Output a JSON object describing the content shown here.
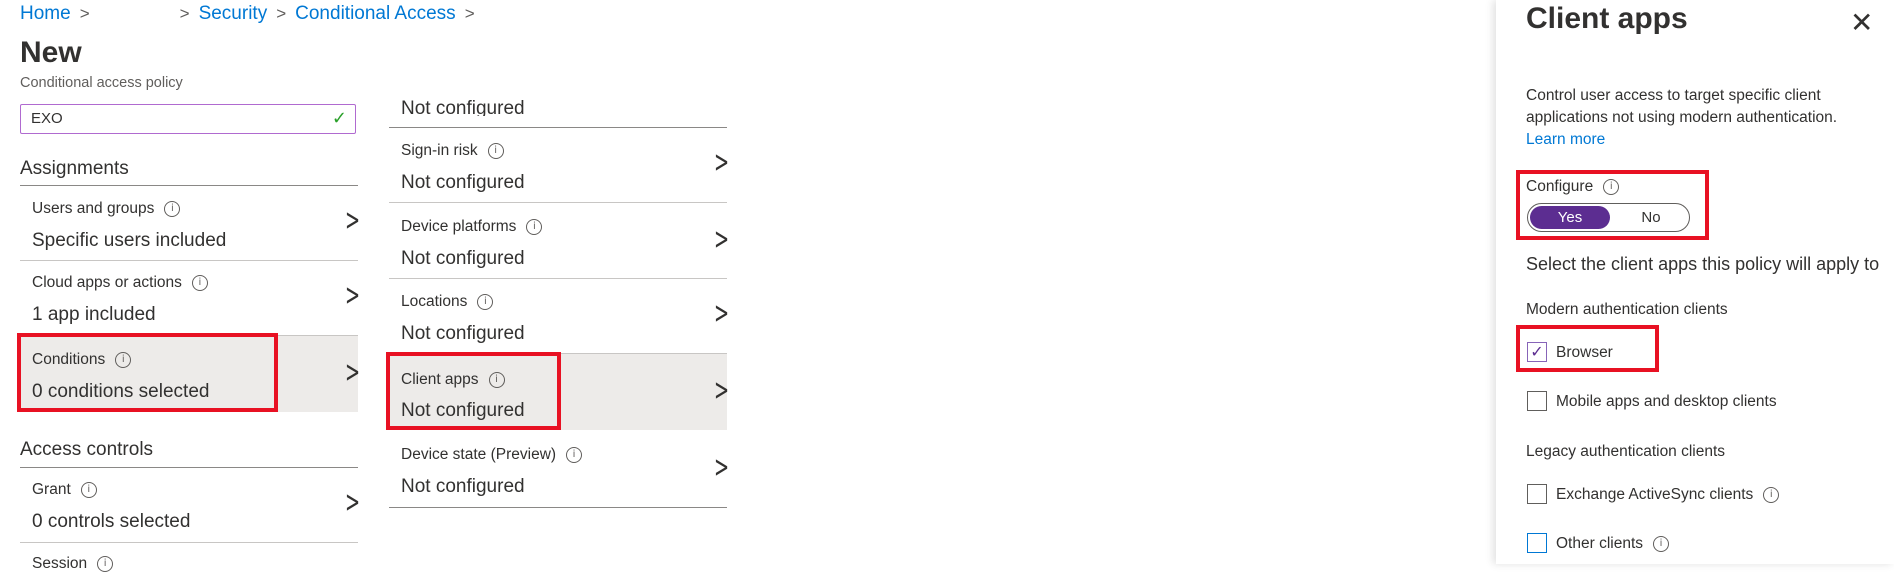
{
  "breadcrumb": {
    "home": "Home",
    "security": "Security",
    "conditional_access": "Conditional Access",
    "sep": ">"
  },
  "page": {
    "title": "New",
    "subtitle": "Conditional access policy",
    "name_value": "EXO"
  },
  "assignments": {
    "title": "Assignments",
    "rows": [
      {
        "label": "Users and groups",
        "value": "Specific users included"
      },
      {
        "label": "Cloud apps or actions",
        "value": "1 app included"
      },
      {
        "label": "Conditions",
        "value": "0 conditions selected"
      }
    ]
  },
  "access_controls": {
    "title": "Access controls",
    "rows": [
      {
        "label": "Grant",
        "value": "0 controls selected"
      },
      {
        "label": "Session"
      }
    ]
  },
  "conditions": {
    "top_value": "Not configured",
    "rows": [
      {
        "label": "Sign-in risk",
        "value": "Not configured"
      },
      {
        "label": "Device platforms",
        "value": "Not configured"
      },
      {
        "label": "Locations",
        "value": "Not configured"
      },
      {
        "label": "Client apps",
        "value": "Not configured"
      },
      {
        "label": "Device state (Preview)",
        "value": "Not configured"
      }
    ]
  },
  "panel": {
    "title": "Client apps",
    "close": "✕",
    "description": "Control user access to target specific client applications not using modern authentication.",
    "learn_more": "Learn more",
    "configure_label": "Configure",
    "toggle_yes": "Yes",
    "toggle_no": "No",
    "select_text": "Select the client apps this policy will apply to",
    "modern_header": "Modern authentication clients",
    "browser": "Browser",
    "mobile": "Mobile apps and desktop clients",
    "legacy_header": "Legacy authentication clients",
    "exchange": "Exchange ActiveSync clients",
    "other": "Other clients"
  },
  "icons": {
    "info": "i",
    "chevron": ">",
    "check": "✓"
  },
  "colors": {
    "accent": "#0078d4",
    "toggle_on": "#5c2d91",
    "highlight_box": "#e81123",
    "selected_row": "#edebe9"
  }
}
